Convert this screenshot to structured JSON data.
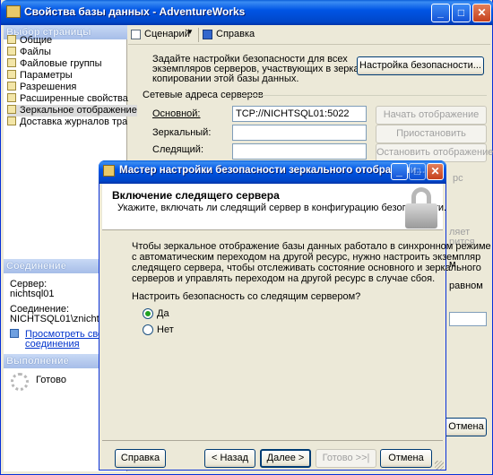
{
  "window": {
    "title": "Свойства базы данных - AdventureWorks",
    "controls": [
      "minimize",
      "maximize",
      "close"
    ]
  },
  "left": {
    "pages_header": "Выбор страницы",
    "pages": [
      {
        "label": "Общие"
      },
      {
        "label": "Файлы"
      },
      {
        "label": "Файловые группы"
      },
      {
        "label": "Параметры"
      },
      {
        "label": "Разрешения"
      },
      {
        "label": "Расширенные свойства"
      },
      {
        "label": "Зеркальное отображение",
        "selected": true
      },
      {
        "label": "Доставка журналов транзакций"
      }
    ],
    "connection_header": "Соединение",
    "server_label": "Сервер:",
    "server_value": "nichtsql01",
    "connection_label": "Соединение:",
    "connection_value": "NICHTSQL01\\znichter",
    "view_link_line1": "Просмотреть свойства",
    "view_link_line2": "соединения",
    "progress_header": "Выполнение",
    "progress_status": "Готово"
  },
  "toolbar": {
    "script_label": "Сценарий",
    "help_label": "Справка"
  },
  "mirroring": {
    "intro_text_1": "Задайте настройки безопасности для всех",
    "intro_text_2": "экземпляров серверов, участвующих в зеркальном",
    "intro_text_3": "копировании этой базы данных.",
    "configure_security_button": "Настройка безопасности...",
    "addresses_group": "Сетевые адреса серверов",
    "principal_label": "Основной:",
    "principal_value": "TCP://NICHTSQL01:5022",
    "mirror_label": "Зеркальный:",
    "mirror_value": "",
    "witness_label": "Следящий:",
    "witness_value": "",
    "start_mirroring_button": "Начать отображение",
    "pause_button": "Приостановить",
    "stop_mirroring_button": "Остановить отображение",
    "behind_fragments": [
      "рс",
      "ляет",
      "рится",
      "м",
      "равном"
    ],
    "cancel_button": "Отмена"
  },
  "dialog": {
    "title": "Мастер настройки безопасности зеркального отображени...",
    "header_title": "Включение следящего сервера",
    "header_subtitle": "Укажите, включать ли следящий сервер в конфигурацию безопасности.",
    "body_line_1": "Чтобы зеркальное отображение базы данных работало в синхронном режиме",
    "body_line_2": "с автоматическим переходом на другой ресурс, нужно настроить экземпляр",
    "body_line_3": "следящего сервера, чтобы отслеживать состояние основного и зеркального",
    "body_line_4": "серверов и управлять переходом на другой ресурс в случае сбоя.",
    "question": "Настроить безопасность со следящим сервером?",
    "option_yes": "Да",
    "option_no": "Нет",
    "selected_option": "yes",
    "help_button": "Справка",
    "back_button": "< Назад",
    "next_button": "Далее >",
    "finish_button": "Готово >>|",
    "cancel_button": "Отмена"
  },
  "colors": {
    "titlebar": "#0055e5",
    "window_bg": "#ece9d8",
    "link": "#0033cc"
  }
}
